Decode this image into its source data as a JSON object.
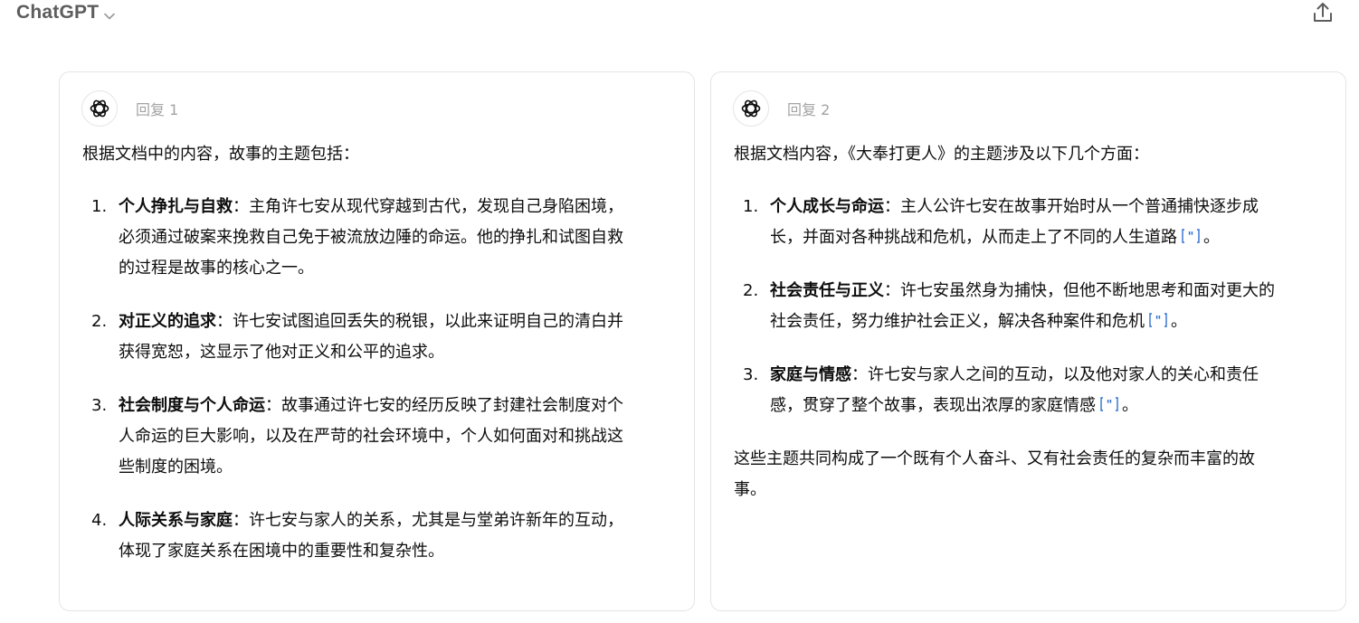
{
  "app": {
    "title": "ChatGPT"
  },
  "icons": {
    "brand_chevron": "chevron-down-icon",
    "share": "share-icon",
    "avatar": "openai-logo-icon",
    "citation": "citation-quote-icon"
  },
  "colors": {
    "brand_text": "#5d5d5d",
    "reply_label": "#a3a3a3",
    "citation": "#2f6fd0",
    "card_border": "#e5e5e5"
  },
  "responses": [
    {
      "label": "回复 1",
      "intro": "根据文档中的内容，故事的主题包括：",
      "items": [
        {
          "number": "1.",
          "heading": "个人挣扎与自救",
          "line1": "：主角许七安从现代穿越到古代，发现自己身陷困境，",
          "line2": "必须通过破案来挽救自己免于被流放边陲的命运。他的挣扎和试图自救",
          "line3": "的过程是故事的核心之一。"
        },
        {
          "number": "2.",
          "heading": "对正义的追求",
          "line1": "：许七安试图追回丢失的税银，以此来证明自己的清白并",
          "line2": "获得宽恕，这显示了他对正义和公平的追求。"
        },
        {
          "number": "3.",
          "heading": "社会制度与个人命运",
          "line1": "：故事通过许七安的经历反映了封建社会制度对个",
          "line2": "人命运的巨大影响，以及在严苛的社会环境中，个人如何面对和挑战这",
          "line3": "些制度的困境。"
        },
        {
          "number": "4.",
          "heading": "人际关系与家庭",
          "line1": "：许七安与家人的关系，尤其是与堂弟许新年的互动，",
          "line2": "体现了家庭关系在困境中的重要性和复杂性。"
        }
      ]
    },
    {
      "label": "回复 2",
      "intro": "根据文档内容，《大奉打更人》的主题涉及以下几个方面：",
      "items": [
        {
          "number": "1.",
          "heading": "个人成长与命运",
          "line1": "：主人公许七安在故事开始时从一个普通捕快逐步成",
          "line2": "长，并面对各种挑战和危机，从而走上了不同的人生道路",
          "end": "。"
        },
        {
          "number": "2.",
          "heading": "社会责任与正义",
          "line1": "：许七安虽然身为捕快，但他不断地思考和面对更大的",
          "line2": "社会责任，努力维护社会正义，解决各种案件和危机",
          "end": "。"
        },
        {
          "number": "3.",
          "heading": "家庭与情感",
          "line1": "：许七安与家人之间的互动，以及他对家人的关心和责任",
          "line2": "感，贯穿了整个故事，表现出浓厚的家庭情感",
          "end": "。"
        }
      ],
      "outro_line1": "这些主题共同构成了一个既有个人奋斗、又有社会责任的复杂而丰富的故",
      "outro_line2": "事。"
    }
  ]
}
